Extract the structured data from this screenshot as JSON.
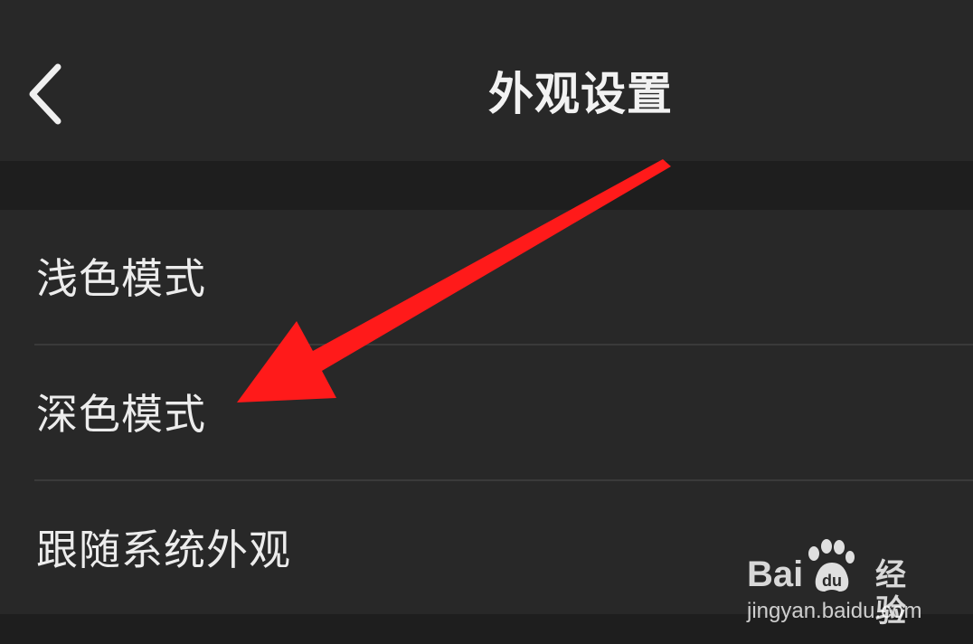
{
  "header": {
    "title": "外观设置",
    "back_icon": "chevron-left-icon"
  },
  "appearance_options": [
    {
      "label": "浅色模式"
    },
    {
      "label": "深色模式"
    },
    {
      "label": "跟随系统外观"
    }
  ],
  "annotation": {
    "type": "red-arrow",
    "color": "#ff1a1a",
    "points_to": "深色模式"
  },
  "watermark": {
    "brand_left": "Bai",
    "brand_right": "经验",
    "url": "jingyan.baidu.com",
    "icon": "paw-icon"
  },
  "colors": {
    "background": "#1c1c1c",
    "panel": "#282828",
    "divider": "#3a3a3a",
    "text": "#ececec"
  }
}
